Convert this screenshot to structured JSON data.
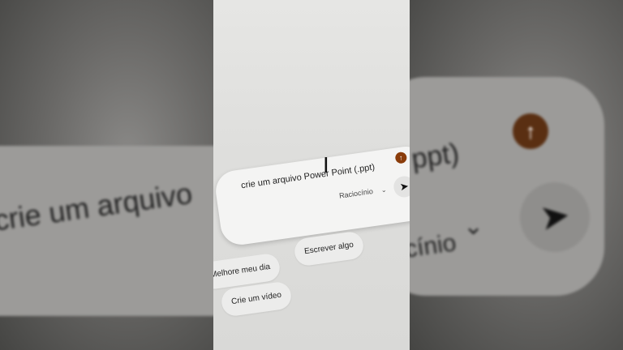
{
  "composer": {
    "prompt_text": "crie um arquivo Power Point (.ppt)",
    "model_label": "Raciocínio",
    "chevron_glyph": "⌄",
    "send_glyph": "➤",
    "upload_glyph": "↑"
  },
  "background_zoom": {
    "left_text": "crie um arquivo",
    "right_text_top": "ppt)",
    "right_text_bottom": "cínio"
  },
  "suggestions": [
    {
      "label": "Melhore meu dia"
    },
    {
      "label": "Escrever algo"
    },
    {
      "label": "Crie um vídeo"
    }
  ],
  "colors": {
    "upload_button": "#8a3c0a",
    "card": "#f4f4f3"
  }
}
